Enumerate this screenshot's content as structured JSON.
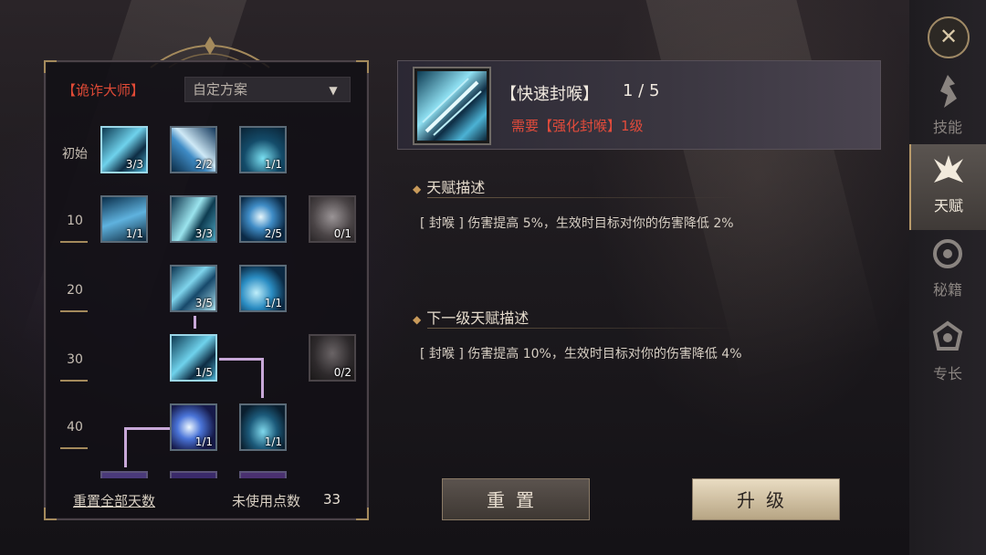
{
  "tree": {
    "class_name": "【诡诈大师】",
    "plan_select": "自定方案",
    "tiers": [
      "初始",
      "10",
      "20",
      "30",
      "40"
    ],
    "nodes": [
      {
        "count": "3/3"
      },
      {
        "count": "2/2"
      },
      {
        "count": "1/1"
      },
      {
        "count": "1/1"
      },
      {
        "count": "3/3"
      },
      {
        "count": "2/5"
      },
      {
        "count": "0/1"
      },
      {
        "count": "3/5"
      },
      {
        "count": "1/1"
      },
      {
        "count": "1/5"
      },
      {
        "count": "0/2"
      },
      {
        "count": "1/1"
      },
      {
        "count": "1/1"
      }
    ],
    "reset_all_label": "重置全部天数",
    "unused_points_label": "未使用点数",
    "unused_points_value": "33"
  },
  "detail": {
    "skill_name": "【快速封喉】",
    "skill_level": "1 / 5",
    "requirement": "需要【强化封喉】1级",
    "desc_title": "天赋描述",
    "desc_text": "[ 封喉 ] 伤害提高 5%，生效时目标对你的伤害降低 2%",
    "next_title": "下一级天赋描述",
    "next_text": "[ 封喉 ] 伤害提高 10%，生效时目标对你的伤害降低 4%"
  },
  "buttons": {
    "reset": "重置",
    "upgrade": "升级"
  },
  "nav": {
    "items": [
      {
        "label": "技能",
        "icon": "skill-icon"
      },
      {
        "label": "天赋",
        "icon": "talent-icon"
      },
      {
        "label": "秘籍",
        "icon": "secret-book-icon"
      },
      {
        "label": "专长",
        "icon": "specialty-icon"
      }
    ],
    "close_icon": "close-icon"
  }
}
